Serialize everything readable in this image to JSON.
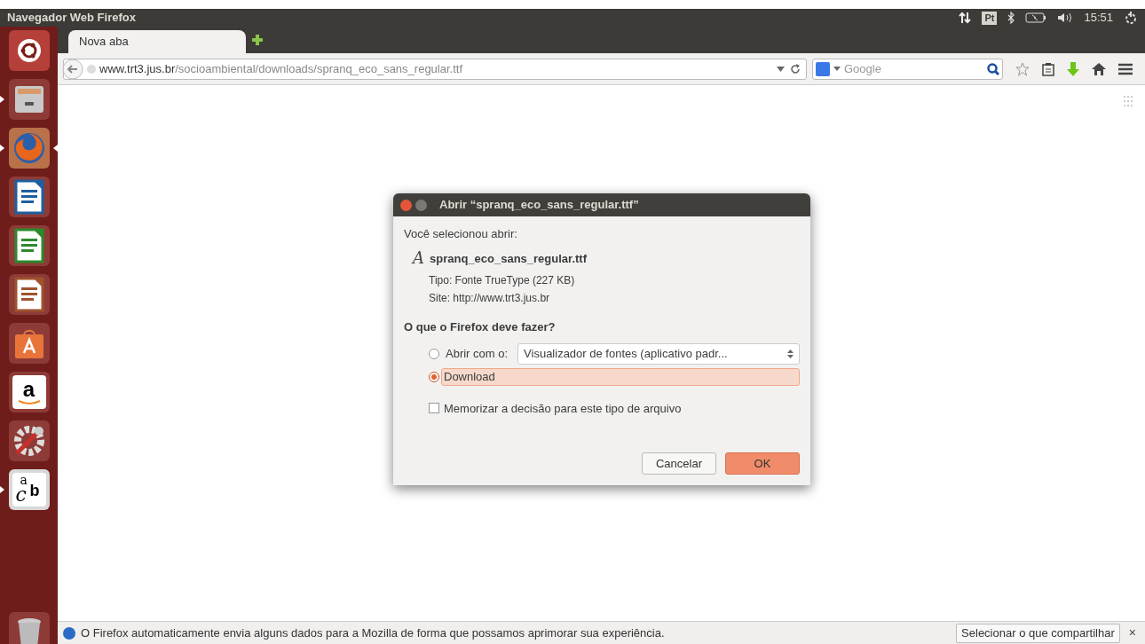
{
  "top_panel": {
    "title": "Navegador Web Firefox",
    "keyboard_layout": "Pt",
    "clock": "15:51"
  },
  "launcher": [
    {
      "kind": "ubuntu",
      "running": false,
      "focused": false
    },
    {
      "kind": "files",
      "running": true,
      "focused": false
    },
    {
      "kind": "firefox",
      "running": true,
      "focused": true
    },
    {
      "kind": "writer",
      "running": false,
      "focused": false
    },
    {
      "kind": "calc",
      "running": false,
      "focused": false
    },
    {
      "kind": "impress",
      "running": false,
      "focused": false
    },
    {
      "kind": "software",
      "running": false,
      "focused": false
    },
    {
      "kind": "amazon",
      "running": false,
      "focused": false,
      "glyphs": [
        "a"
      ]
    },
    {
      "kind": "settings",
      "running": false,
      "focused": false
    },
    {
      "kind": "fonts",
      "running": true,
      "focused": false,
      "glyphs": [
        "a",
        "c",
        "b"
      ]
    }
  ],
  "tabs": [
    {
      "label": "Nova aba",
      "selected": true
    }
  ],
  "url_bar": {
    "host": "www.trt3.jus.br",
    "path": "/socioambiental/downloads/spranq_eco_sans_regular.ttf"
  },
  "search_bar": {
    "placeholder": "Google"
  },
  "dialog": {
    "title": "Abrir “spranq_eco_sans_regular.ttf”",
    "intro": "Você selecionou abrir:",
    "file_icon": "A",
    "file_name": "spranq_eco_sans_regular.ttf",
    "type": "Tipo: Fonte TrueType (227 KB)",
    "site": "Site: http://www.trt3.jus.br",
    "question": "O que o Firefox deve fazer?",
    "options": [
      {
        "kind": "open_with",
        "label": "Abrir com o:",
        "selected": false,
        "app": "Visualizador de fontes (aplicativo padr..."
      },
      {
        "kind": "download",
        "label": "Download",
        "selected": true
      }
    ],
    "remember": {
      "label": "Memorizar a decisão para este tipo de arquivo",
      "checked": false
    },
    "buttons": [
      {
        "label": "Cancelar",
        "default": false
      },
      {
        "label": "OK",
        "default": true
      }
    ]
  },
  "notification": {
    "text": "O Firefox automaticamente envia alguns dados para a Mozilla de forma que possamos aprimorar sua experiência.",
    "button": "Selecionar o que compartilhar",
    "close": "×"
  }
}
